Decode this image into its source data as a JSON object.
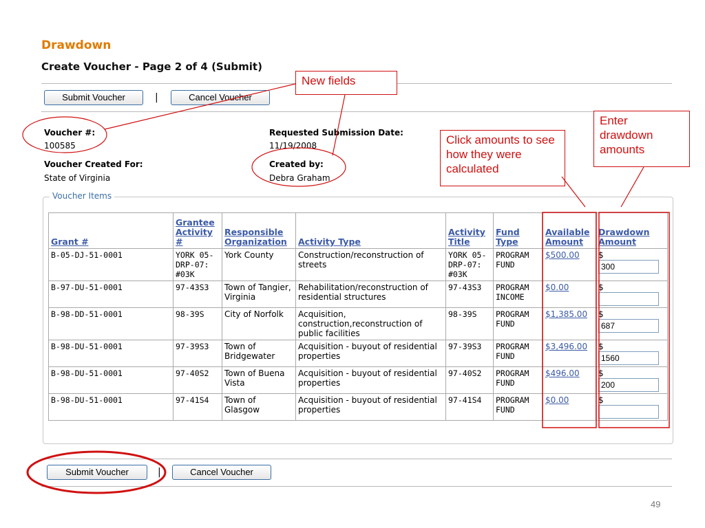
{
  "header": {
    "title": "Drawdown",
    "subtitle": "Create Voucher - Page 2 of 4 (Submit)"
  },
  "toolbar": {
    "submit_label": "Submit Voucher",
    "separator": "|",
    "cancel_label": "Cancel Voucher"
  },
  "voucher": {
    "number_label": "Voucher #:",
    "number_value": "100585",
    "created_for_label": "Voucher Created For:",
    "created_for_value": "State of Virginia",
    "submission_date_label": "Requested Submission Date:",
    "submission_date_value": "11/19/2008",
    "created_by_label": "Created by:",
    "created_by_value": "Debra Graham"
  },
  "items": {
    "legend": "Voucher Items",
    "columns": {
      "grant": "Grant #",
      "grantee_activity": "Grantee Activity #",
      "responsible_org": "Responsible Organization",
      "activity_type": "Activity Type",
      "activity_title": "Activity Title",
      "fund_type": "Fund Type",
      "available_amount": "Available Amount",
      "drawdown_amount": "Drawdown Amount"
    },
    "currency_symbol": "$",
    "rows": [
      {
        "grant": "B-05-DJ-51-0001",
        "grantee_activity": "YORK 05-DRP-07: #03K",
        "responsible_org": "York County",
        "activity_type": "Construction/reconstruction of streets",
        "activity_title": "YORK 05-DRP-07: #03K",
        "fund_type": "PROGRAM FUND",
        "available_amount": "$500.00",
        "drawdown": "300"
      },
      {
        "grant": "B-97-DU-51-0001",
        "grantee_activity": "97-43S3",
        "responsible_org": "Town of Tangier, Virginia",
        "activity_type": "Rehabilitation/reconstruction of residential structures",
        "activity_title": "97-43S3",
        "fund_type": "PROGRAM INCOME",
        "available_amount": "$0.00",
        "drawdown": ""
      },
      {
        "grant": "B-98-DD-51-0001",
        "grantee_activity": "98-39S",
        "responsible_org": "City of Norfolk",
        "activity_type": "Acquisition, construction,reconstruction of public facilities",
        "activity_title": "98-39S",
        "fund_type": "PROGRAM FUND",
        "available_amount": "$1,385.00",
        "drawdown": "687"
      },
      {
        "grant": "B-98-DU-51-0001",
        "grantee_activity": "97-39S3",
        "responsible_org": "Town of Bridgewater",
        "activity_type": "Acquisition - buyout of residential properties",
        "activity_title": "97-39S3",
        "fund_type": "PROGRAM FUND",
        "available_amount": "$3,496.00",
        "drawdown": "1560"
      },
      {
        "grant": "B-98-DU-51-0001",
        "grantee_activity": "97-40S2",
        "responsible_org": "Town of Buena Vista",
        "activity_type": "Acquisition - buyout of residential properties",
        "activity_title": "97-40S2",
        "fund_type": "PROGRAM FUND",
        "available_amount": "$496.00",
        "drawdown": "200"
      },
      {
        "grant": "B-98-DU-51-0001",
        "grantee_activity": "97-41S4",
        "responsible_org": "Town of Glasgow",
        "activity_type": "Acquisition - buyout of residential properties",
        "activity_title": "97-41S4",
        "fund_type": "PROGRAM FUND",
        "available_amount": "$0.00",
        "drawdown": ""
      }
    ]
  },
  "annotations": {
    "new_fields": "New fields",
    "click_amounts": "Click amounts to see how they were calculated",
    "enter_drawdown": "Enter drawdown amounts",
    "color": "#d01010"
  },
  "footer": {
    "page_number": "49"
  },
  "colors": {
    "title": "#e07b00",
    "link": "#3b5aa6",
    "button_border": "#3a6ea5"
  }
}
